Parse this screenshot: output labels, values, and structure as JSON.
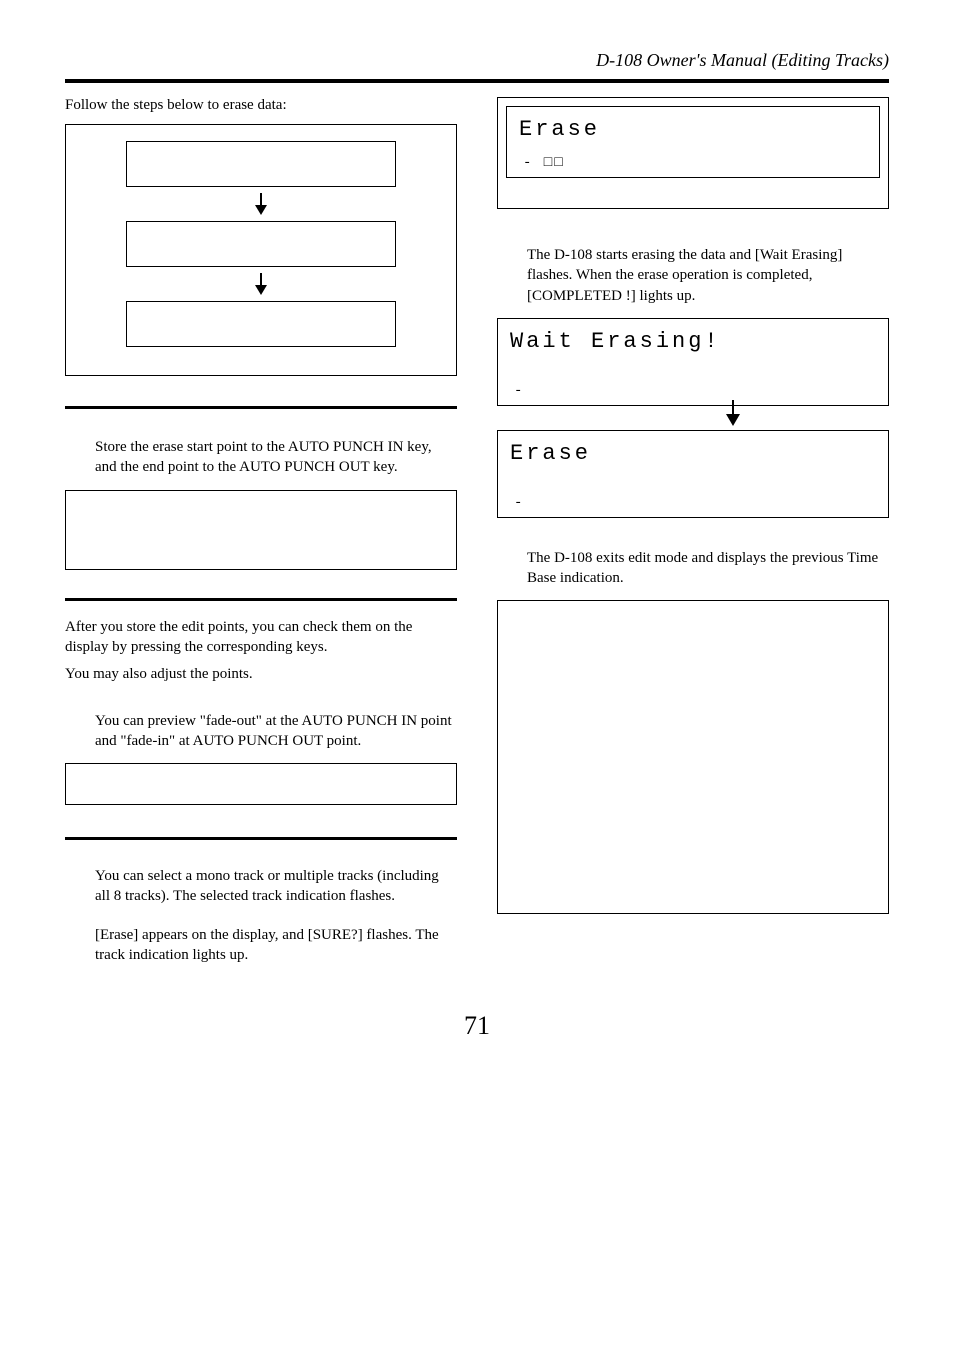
{
  "header": {
    "title": "D-108 Owner's Manual (Editing Tracks)"
  },
  "left": {
    "intro": "Follow the steps below to erase data:",
    "step1": "Store the erase start point to the AUTO PUNCH IN key, and the end point to the AUTO PUNCH OUT key.",
    "afterStore1": "After you store the edit points, you can check them on the display by pressing the corresponding keys.",
    "afterStore2": "You may also adjust the points.",
    "preview": "You can preview \"fade-out\" at the AUTO PUNCH IN point and \"fade-in\" at AUTO PUNCH OUT point.",
    "selectTrack": "You can select a mono track or multiple tracks (including all 8 tracks).  The selected track indication flashes.",
    "eraseSure": "[Erase] appears on the display, and [SURE?] flashes.  The track indication lights up."
  },
  "right": {
    "lcd1": {
      "main": "Erase",
      "sub": "- □□"
    },
    "explainErase": "The D-108 starts erasing the data and [Wait Erasing] flashes.  When the erase operation is completed, [COMPLETED !] lights up.",
    "lcdWait": {
      "main": "Wait Erasing!",
      "sub": "-"
    },
    "lcdDone": {
      "main": "Erase",
      "sub": "-"
    },
    "exitText": "The D-108 exits edit mode and displays the previous Time Base indication."
  },
  "pageNumber": "71"
}
